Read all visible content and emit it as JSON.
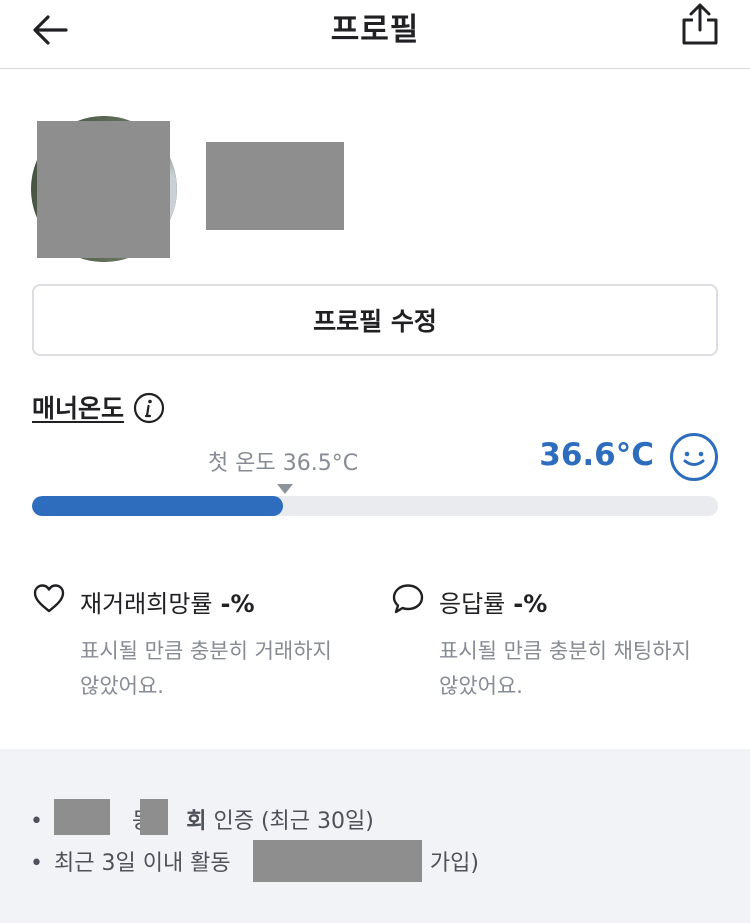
{
  "header": {
    "title": "프로필",
    "back_icon": "arrow-left-icon",
    "share_icon": "share-icon"
  },
  "profile": {
    "edit_button_label": "프로필 수정"
  },
  "manner": {
    "label": "매너온도",
    "first_temp_label": "첫 온도 36.5°C",
    "temperature": "36.6°C",
    "temperature_value": 36.6,
    "fill_percent": 36.6,
    "accent_color": "#2e6dbd"
  },
  "stats": {
    "rehire": {
      "title": "재거래희망률",
      "value": "-%",
      "description": "표시될 만큼 충분히 거래하지 않았어요.",
      "icon": "heart-icon"
    },
    "response": {
      "title": "응답률",
      "value": "-%",
      "description": "표시될 만큼 충분히 채팅하지 않았어요.",
      "icon": "chat-bubble-icon"
    }
  },
  "footer": {
    "bullet": "•",
    "line1_part_a": "동",
    "line1_part_b": "회",
    "line1_part_c": "인증 (최근 30일)",
    "line2_part_a": "최근 3일 이내 활동",
    "line2_part_b": "일 가입)"
  }
}
